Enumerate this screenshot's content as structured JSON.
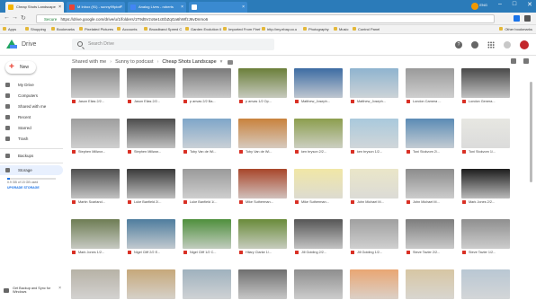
{
  "browser": {
    "tabs": [
      {
        "label": "Cheap Shots Landscape",
        "active": true,
        "color": "#f4b400"
      },
      {
        "label": "M Inbox (91) - sunny99pics",
        "active": false,
        "color": "#ea4335"
      },
      {
        "label": "Analog Lives - roberts",
        "active": false,
        "color": "#4285f4"
      },
      {
        "label": "",
        "active": false,
        "color": "#ffffff"
      }
    ],
    "window_user": "ENG",
    "secure_label": "Secure",
    "url": "https://drive.google.com/drive/u/1/folders/1T9d5Vzo5e1cEbZqGa6hWfzJ6vDnmo6",
    "bookmarks": [
      "Apps",
      "Shopping",
      "Bookmarks",
      "Pixelated Pictures",
      "Accounts",
      "Broadband Speed C",
      "Garden Evolution 0",
      "Imported From Firef",
      "http://my.ebay.co.u",
      "Photography",
      "Music",
      "Control Panel"
    ],
    "other_bookmarks": "Other bookmarks"
  },
  "drive": {
    "title": "Drive",
    "search_placeholder": "Search Drive",
    "new_label": "New",
    "sidebar": [
      {
        "label": "My Drive",
        "selected": false
      },
      {
        "label": "Computers",
        "selected": false
      },
      {
        "label": "Shared with me",
        "selected": false
      },
      {
        "label": "Recent",
        "selected": false
      },
      {
        "label": "Starred",
        "selected": false
      },
      {
        "label": "Trash",
        "selected": false
      },
      {
        "label": "Backups",
        "selected": false
      },
      {
        "label": "Storage",
        "selected": true
      }
    ],
    "storage_used_fraction": 0.06,
    "storage_text": "0.9 GB of 15 GB used",
    "upgrade_label": "UPGRADE STORAGE",
    "breadcrumb": [
      "Shared with me",
      "Sunny to podcast",
      "Cheap Shots Landscape"
    ],
    "backup_banner": "Get Backup and Sync for Windows",
    "files": [
      {
        "name": "Jason Elias 2/2...",
        "tone": "#8a8a8a"
      },
      {
        "name": "Jason Elias 2/2...",
        "tone": "#6b6b6b"
      },
      {
        "name": "p anvas 2/2 Ba...",
        "tone": "#7a7a7a"
      },
      {
        "name": "p anvas 1/2 Op...",
        "tone": "#6b7f3a"
      },
      {
        "name": "Matthew_Joseph...",
        "tone": "#3d6ca3"
      },
      {
        "name": "Matthew_Joseph...",
        "tone": "#8fb4cf"
      },
      {
        "name": "London Camera ...",
        "tone": "#9a9a9a"
      },
      {
        "name": "London Genera...",
        "tone": "#4a4a4a"
      },
      {
        "name": "Stephen Millwor...",
        "tone": "#9e9e9e"
      },
      {
        "name": "Stephen Millwar...",
        "tone": "#4d4d4d"
      },
      {
        "name": "Toby Van de Wi...",
        "tone": "#7fa6c9"
      },
      {
        "name": "Toby Van de Wi...",
        "tone": "#c9823c"
      },
      {
        "name": "ken bryson 2/2...",
        "tone": "#8c9e4e"
      },
      {
        "name": "ken bryson 1/2...",
        "tone": "#a9c9dc"
      },
      {
        "name": "Toni Stokvom 2/...",
        "tone": "#5b8bb5"
      },
      {
        "name": "Toni Stokvom 1/...",
        "tone": "#e7e7e2"
      },
      {
        "name": "Martin Scarland...",
        "tone": "#505050"
      },
      {
        "name": "Luke Banfield 2/...",
        "tone": "#3a3a3a"
      },
      {
        "name": "Luke Banfield 1/...",
        "tone": "#9a9a9a"
      },
      {
        "name": "Mike Sutherman...",
        "tone": "#a8462a"
      },
      {
        "name": "Mike Sutherman...",
        "tone": "#f1e7a6"
      },
      {
        "name": "John Michael M...",
        "tone": "#eae6c8"
      },
      {
        "name": "John Michael M...",
        "tone": "#8c8c8c"
      },
      {
        "name": "Mark Jones 2/2...",
        "tone": "#1d1d1d"
      },
      {
        "name": "Mark Jones 1/2...",
        "tone": "#6e7d54"
      },
      {
        "name": "Nigel Cliff 2/2 E...",
        "tone": "#4f7d9e"
      },
      {
        "name": "Nigel Cliff 1/2 C...",
        "tone": "#4f8f3c"
      },
      {
        "name": "Hilary Clarke 1/...",
        "tone": "#6a8b3a"
      },
      {
        "name": "Jill Golding 2/2...",
        "tone": "#565656"
      },
      {
        "name": "Jill Golding 1/2...",
        "tone": "#a0a0a0"
      },
      {
        "name": "Steve Tavler 2/2...",
        "tone": "#7d7d7d"
      },
      {
        "name": "Steve Tavler 1/2...",
        "tone": "#8f8f8f"
      },
      {
        "name": "",
        "tone": "#b7b2a6"
      },
      {
        "name": "",
        "tone": "#c6a87a"
      },
      {
        "name": "",
        "tone": "#9fb1be"
      },
      {
        "name": "",
        "tone": "#6f6f6f"
      },
      {
        "name": "",
        "tone": "#8e8e8e"
      },
      {
        "name": "",
        "tone": "#e9a673"
      },
      {
        "name": "",
        "tone": "#d7c6a3"
      },
      {
        "name": "",
        "tone": "#b9c7d3"
      }
    ]
  },
  "colors": {
    "title_bar": "#2b7bb9",
    "accent": "#1a73e8",
    "file_icon": "#d93025"
  }
}
